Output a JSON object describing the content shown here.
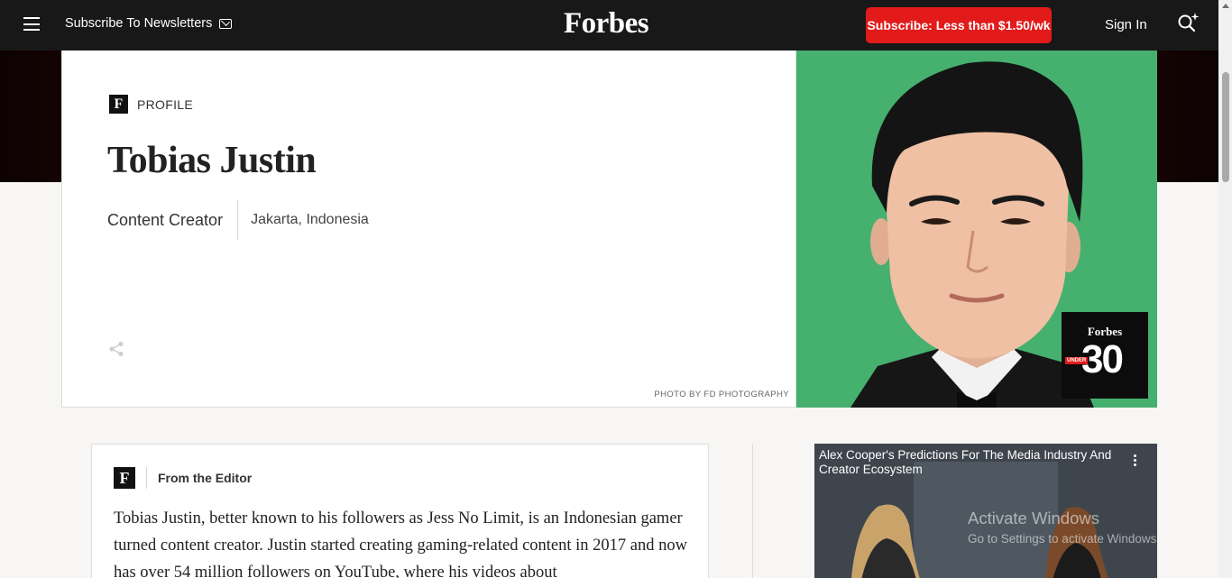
{
  "header": {
    "newsletter_label": "Subscribe To Newsletters",
    "logo": "Forbes",
    "subscribe_label": "Subscribe: Less than $1.50/wk",
    "signin_label": "Sign In"
  },
  "profile": {
    "badge_letter": "F",
    "tag": "PROFILE",
    "name": "Tobias Justin",
    "role": "Content Creator",
    "location": "Jakarta, Indonesia",
    "photo_credit": "PHOTO BY FD PHOTOGRAPHY"
  },
  "badge": {
    "brand": "Forbes",
    "number": "30",
    "sub": "UNDER"
  },
  "editor": {
    "badge_letter": "F",
    "title": "From the Editor",
    "body": "Tobias Justin, better known to his followers as Jess No Limit, is an Indonesian gamer turned content creator. Justin started creating gaming-related content in 2017 and now has over 54 million followers on YouTube, where his videos about"
  },
  "video": {
    "title": "Alex Cooper's Predictions For The Media Industry And Creator Ecosystem"
  },
  "watermark": {
    "title": "Activate Windows",
    "subtitle": "Go to Settings to activate Windows."
  },
  "colors": {
    "nav_bg": "#181818",
    "subscribe_red": "#e21a1a",
    "photo_green": "#46b06f"
  }
}
